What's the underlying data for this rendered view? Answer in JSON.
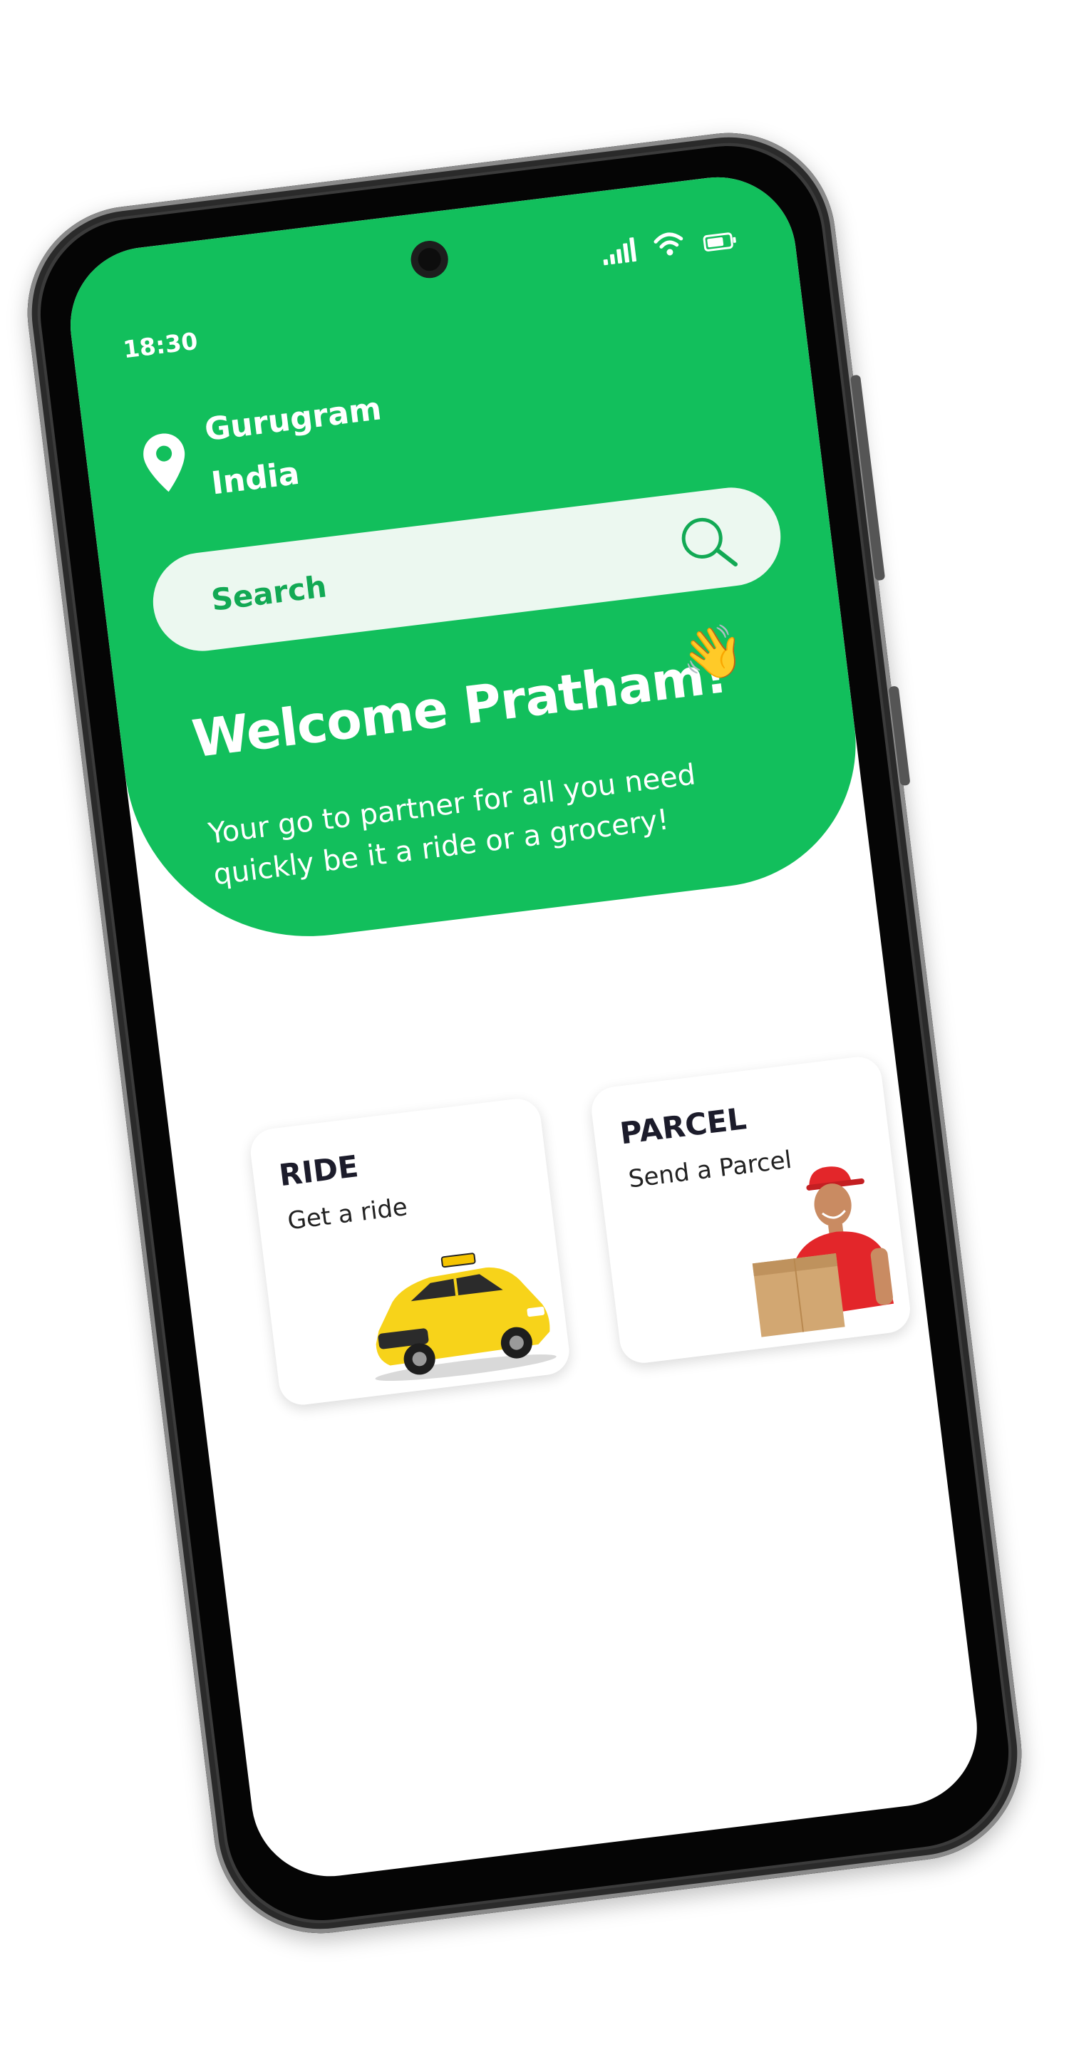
{
  "status_bar": {
    "time": "18:30",
    "icons": [
      "signal-icon",
      "wifi-icon",
      "battery-icon"
    ]
  },
  "location": {
    "icon": "location-pin-icon",
    "city": "Gurugram",
    "country": "India"
  },
  "search": {
    "placeholder": "Search",
    "icon": "search-icon"
  },
  "greeting": {
    "title": "Welcome Pratham!",
    "emoji": "👋",
    "subtitle": "Your go to partner for all you need quickly be it a ride or a grocery!"
  },
  "services": [
    {
      "title": "RIDE",
      "subtitle": "Get a ride",
      "image": "taxi-car-image"
    },
    {
      "title": "PARCEL",
      "subtitle": "Send a Parcel",
      "image": "delivery-man-image"
    }
  ],
  "colors": {
    "primary": "#12bf5c",
    "search_bg": "#ecf8f0",
    "search_text": "#12a954",
    "card_title": "#1c1c2b",
    "phone_frame": "#3b3b3b"
  }
}
